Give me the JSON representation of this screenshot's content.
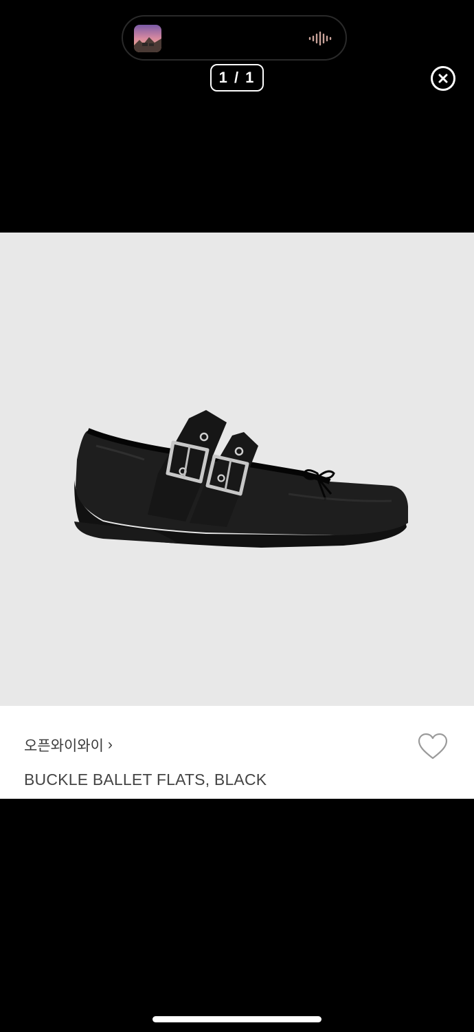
{
  "viewer": {
    "counter": "1 / 1",
    "close_icon": "close-circle-icon"
  },
  "now_playing": {
    "artwork_icon": "album-artwork-thumbnail",
    "wave_icon": "audio-waveform-icon",
    "wave_color": "#c9a39a"
  },
  "product": {
    "brand": "오픈와이와이",
    "brand_chevron": "›",
    "name": "BUCKLE BALLET FLATS, BLACK",
    "image_background": "#e8e8e8",
    "wishlist_icon": "heart-outline-icon"
  }
}
